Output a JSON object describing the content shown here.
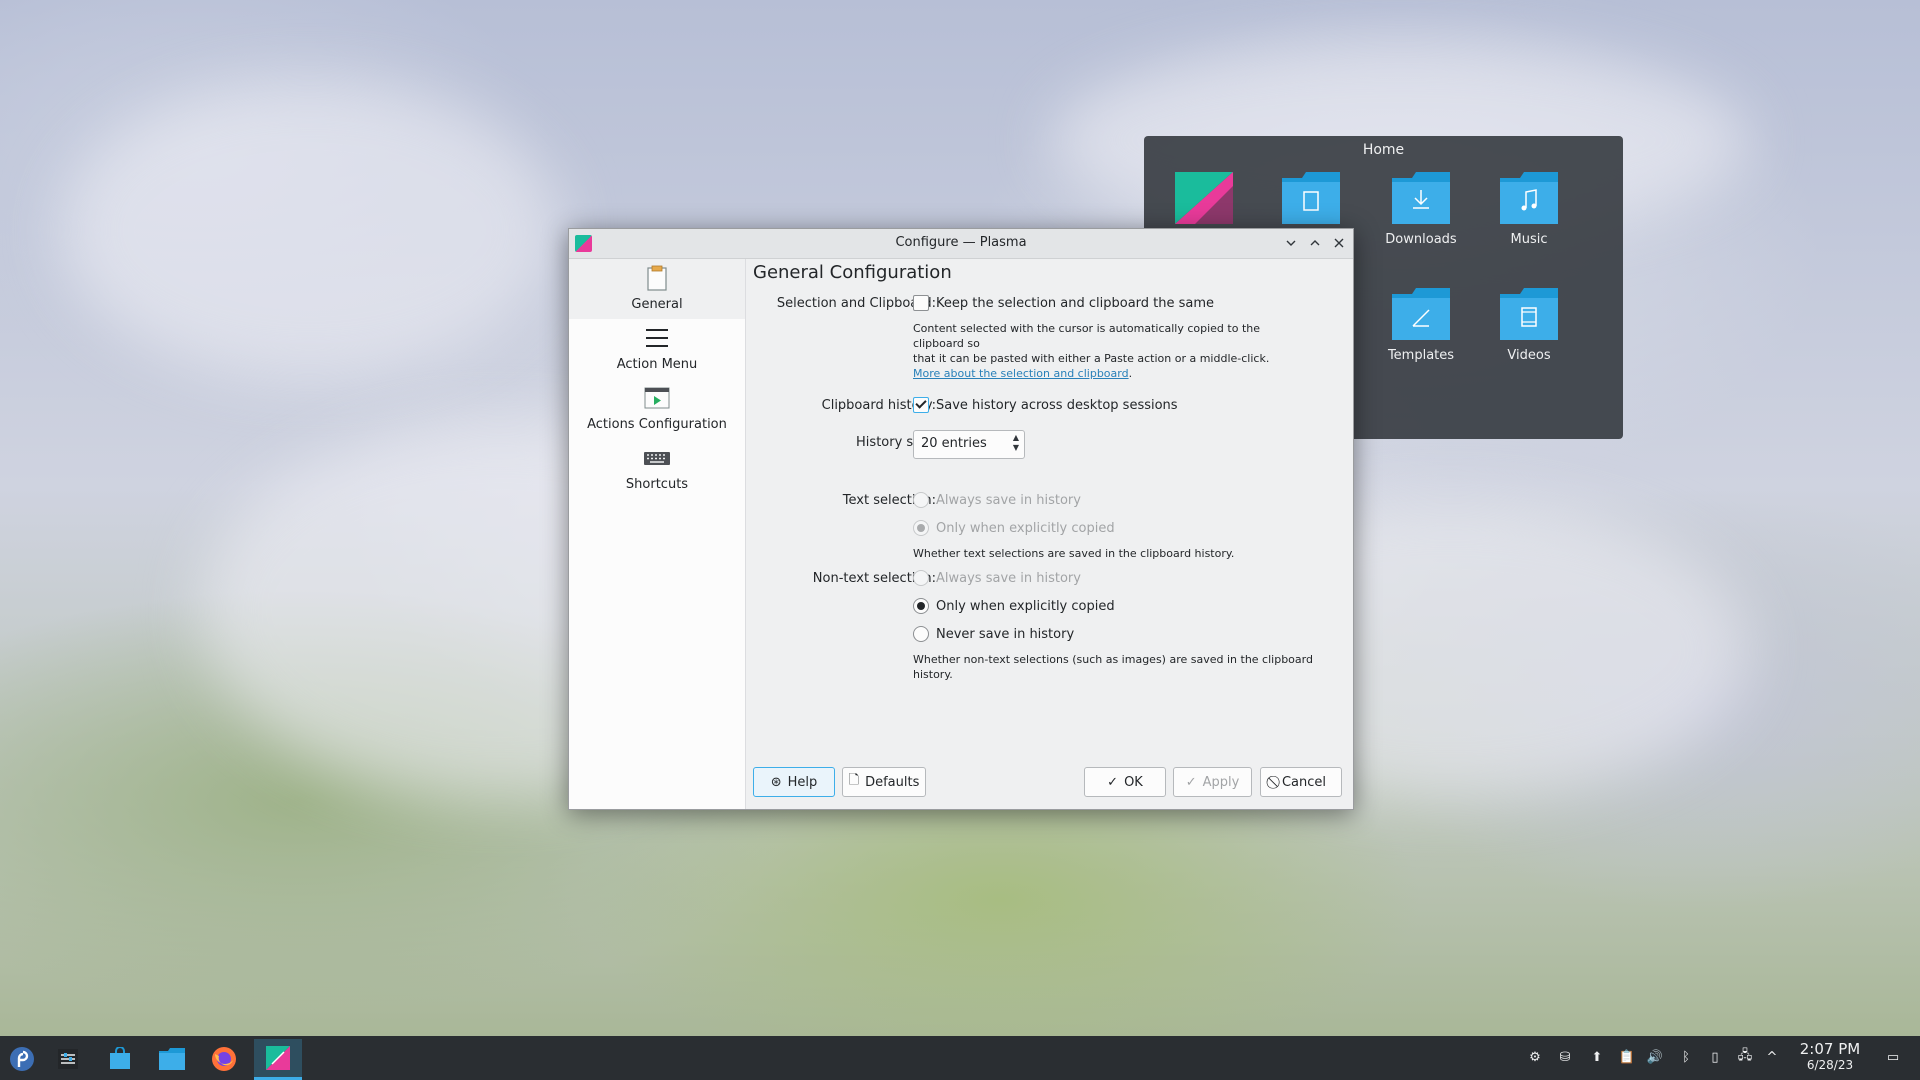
{
  "desktop": {
    "folder_view": {
      "title": "Home",
      "items": [
        {
          "label": "",
          "icon": "image-file-icon"
        },
        {
          "label": "",
          "icon": "documents-folder-icon"
        },
        {
          "label": "Downloads",
          "icon": "downloads-folder-icon"
        },
        {
          "label": "Music",
          "icon": "music-folder-icon"
        },
        {
          "label": "Templates",
          "icon": "templates-folder-icon"
        },
        {
          "label": "Videos",
          "icon": "videos-folder-icon"
        }
      ]
    }
  },
  "window": {
    "title": "Configure — Plasma",
    "sidebar": [
      {
        "label": "General",
        "icon": "clipboard-icon",
        "selected": true
      },
      {
        "label": "Action Menu",
        "icon": "menu-icon"
      },
      {
        "label": "Actions Configuration",
        "icon": "run-script-icon"
      },
      {
        "label": "Shortcuts",
        "icon": "keyboard-icon"
      }
    ],
    "content": {
      "heading": "General Configuration",
      "selection_clipboard_label": "Selection and Clipboard:",
      "keep_same_label": "Keep the selection and clipboard the same",
      "keep_same_checked": false,
      "selection_help_line1": "Content selected with the cursor is automatically copied to the clipboard so",
      "selection_help_line2": "that it can be pasted with either a Paste action or a middle-click.",
      "selection_help_link": "More about the selection and clipboard",
      "selection_help_link_suffix": ".",
      "clipboard_history_label": "Clipboard history:",
      "save_history_label": "Save history across desktop sessions",
      "save_history_checked": true,
      "history_size_label": "History size:",
      "history_size_value": "20 entries",
      "text_selection_label": "Text selection:",
      "text_always_label": "Always save in history",
      "text_explicit_label": "Only when explicitly copied",
      "text_selection_help": "Whether text selections are saved in the clipboard history.",
      "nontext_selection_label": "Non-text selection:",
      "nontext_always_label": "Always save in history",
      "nontext_explicit_label": "Only when explicitly copied",
      "nontext_never_label": "Never save in history",
      "nontext_help_line1": "Whether non-text selections (such as images) are saved in the clipboard",
      "nontext_help_line2": "history."
    },
    "buttons": {
      "help": "Help",
      "defaults": "Defaults",
      "ok": "OK",
      "apply": "Apply",
      "cancel": "Cancel"
    }
  },
  "taskbar": {
    "clock_time": "2:07 PM",
    "clock_date": "6/28/23"
  },
  "colors": {
    "accent": "#3daee9",
    "panel": "#2a2e32",
    "folder": "#3daee9"
  }
}
